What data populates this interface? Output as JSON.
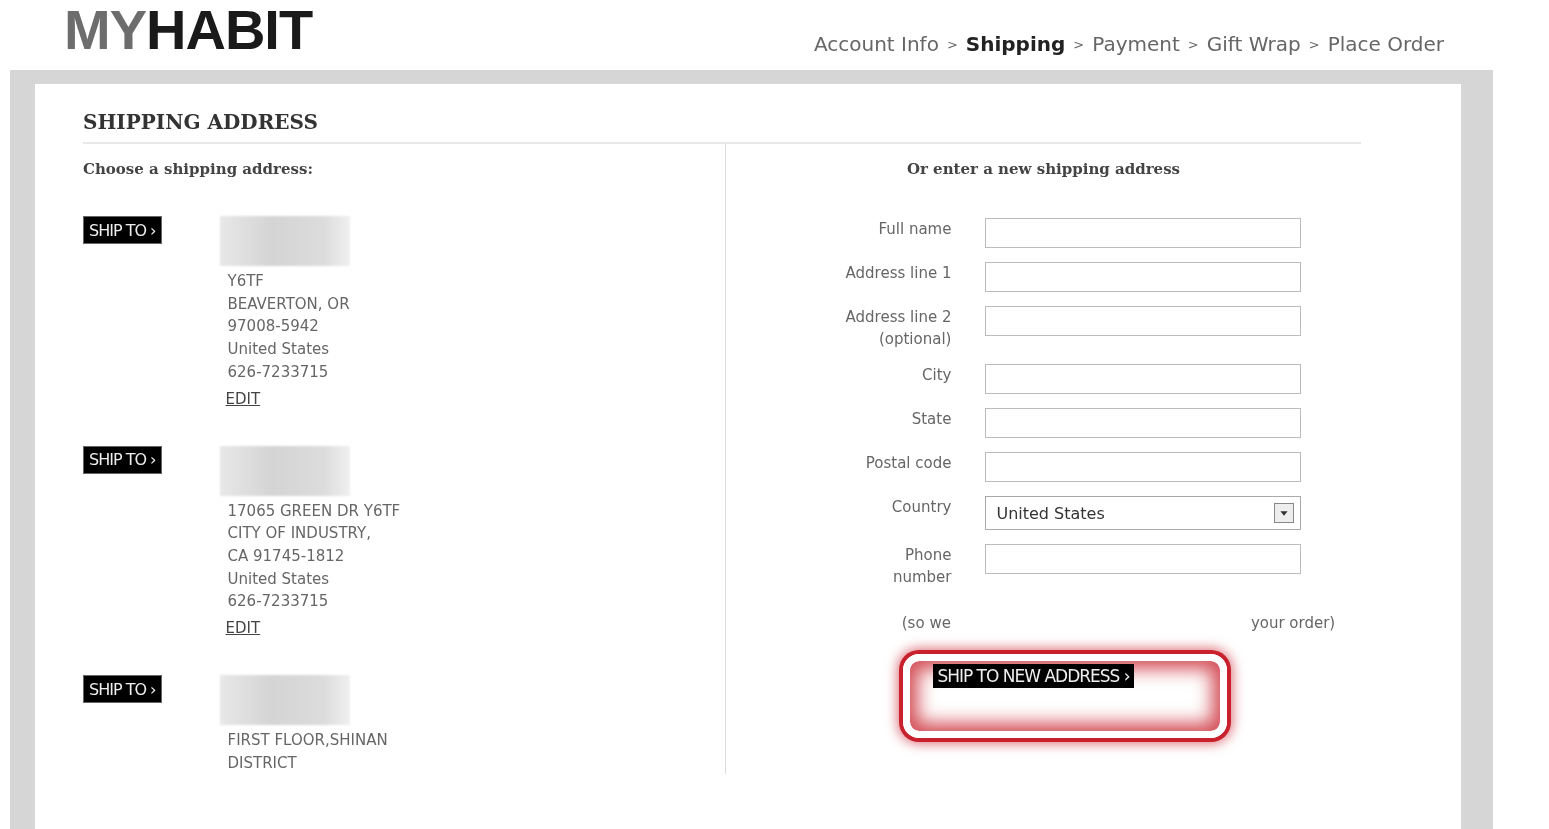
{
  "logo": {
    "prefix": "MY",
    "main": "HABIT"
  },
  "steps": [
    {
      "label": "Account Info",
      "selected": false
    },
    {
      "label": "Shipping",
      "selected": true
    },
    {
      "label": "Payment",
      "selected": false
    },
    {
      "label": "Gift Wrap",
      "selected": false
    },
    {
      "label": "Place Order",
      "selected": false
    }
  ],
  "step_separator": ">",
  "section_title": "SHIPPING ADDRESS",
  "saved": {
    "heading": "Choose a shipping address:",
    "addresses": [
      {
        "button": "SHIP TO ›",
        "lines": [
          "Y6TF",
          "BEAVERTON, OR",
          "97008-5942",
          "United States",
          "626-7233715"
        ],
        "edit": "EDIT"
      },
      {
        "button": "SHIP TO ›",
        "lines": [
          "17065 GREEN DR Y6TF",
          "CITY OF INDUSTRY,",
          "CA 91745-1812",
          "United States",
          "626-7233715"
        ],
        "edit": "EDIT"
      },
      {
        "button": "SHIP TO ›",
        "lines": [
          "FIRST FLOOR,SHINAN",
          "DISTRICT"
        ]
      }
    ]
  },
  "new_address": {
    "heading": "Or enter a new shipping address",
    "fields": [
      {
        "kind": "text",
        "label": "Full name"
      },
      {
        "kind": "text",
        "label": "Address line 1"
      },
      {
        "kind": "text",
        "label": "Address line 2",
        "hint": "(optional)"
      },
      {
        "kind": "text",
        "label": "City"
      },
      {
        "kind": "text",
        "label": "State"
      },
      {
        "kind": "text",
        "label": "Postal code"
      },
      {
        "kind": "select",
        "label": "Country",
        "value": "United States"
      },
      {
        "kind": "text",
        "label": "Phone",
        "hint": "number"
      }
    ],
    "note_start": "(so we",
    "note_end": "your order)",
    "submit": "SHIP TO NEW ADDRESS ›"
  }
}
